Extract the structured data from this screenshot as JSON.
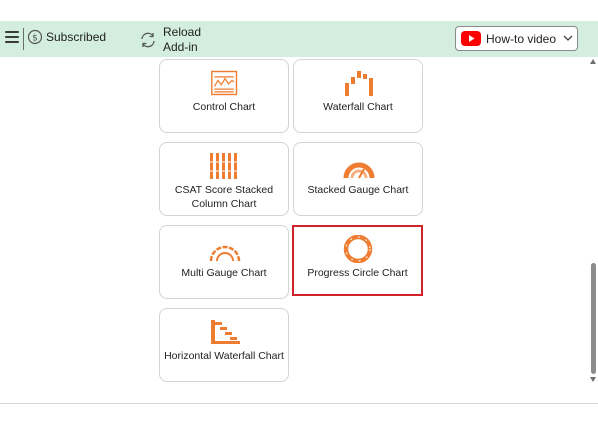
{
  "header": {
    "subscription_status": "Subscribed",
    "reload_label_line1": "Reload",
    "reload_label_line2": "Add-in",
    "howto_label": "How-to video"
  },
  "charts": [
    {
      "label": "Control Chart",
      "icon": "control-chart-icon"
    },
    {
      "label": "Waterfall Chart",
      "icon": "waterfall-chart-icon"
    },
    {
      "label": "CSAT Score Stacked Column Chart",
      "icon": "csat-stacked-column-icon"
    },
    {
      "label": "Stacked Gauge Chart",
      "icon": "stacked-gauge-icon"
    },
    {
      "label": "Multi Gauge Chart",
      "icon": "multi-gauge-icon"
    },
    {
      "label": "Progress Circle Chart",
      "icon": "progress-circle-icon",
      "selected": true
    },
    {
      "label": "Horizontal Waterfall Chart",
      "icon": "horizontal-waterfall-icon"
    }
  ],
  "colors": {
    "accent": "#ee7d31",
    "header_bg": "#d3eedf",
    "selection_border": "#d1222c",
    "youtube_red": "#ff0000"
  }
}
